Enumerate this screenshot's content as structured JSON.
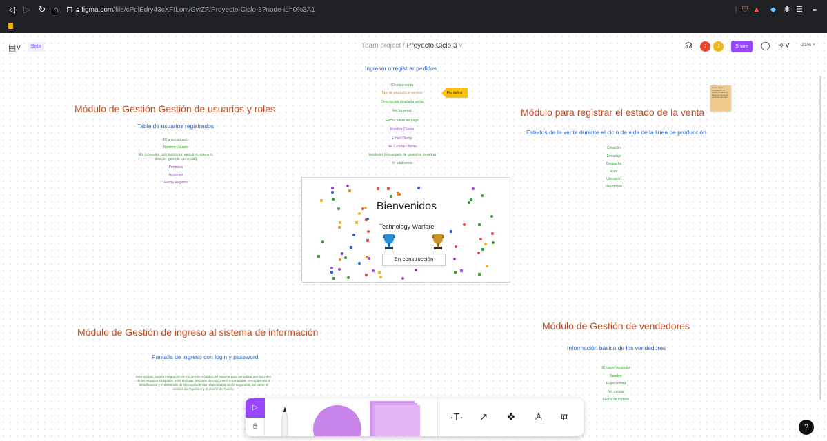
{
  "browser": {
    "host": "figma.com",
    "path": "/file/cPqlEdry43cXFfLonvGwZF/Proyecto-Ciclo-3?node-id=0%3A1"
  },
  "figma": {
    "beta_label": "Beta",
    "team": "Team project",
    "separator": "/",
    "file_name": "Proyecto Ciclo 3",
    "share_label": "Share",
    "zoom": "21%",
    "avatar_1": "J",
    "avatar_2": "J",
    "colors": {
      "accent": "#9747ff",
      "section_title": "#c54a1f",
      "subtitle": "#2a63c7",
      "item_green": "#33a02c",
      "item_purple": "#9b45d6"
    }
  },
  "board": {
    "pedidos": {
      "subtitle": "Ingresar o registrar  pedidos",
      "items": [
        "ID unico venta",
        "Tipo de producto o servicio",
        "Descripcion detallada venta",
        "Fecha venat",
        "Fecha futuro de pago",
        "Nombre Cliente",
        "Email Cliente",
        "No. Celular Cliente",
        "Vendedor (Encargado de gestionar la venta)",
        "Vr total venta"
      ],
      "tag": "Por definir"
    },
    "usuarios": {
      "title": "Módulo de Gestión Gestión de usuarios y roles",
      "subtitle": "Tabla de usuarios registrados",
      "items": [
        "ID unico usuario",
        "Nombre Usuario",
        "Rol (consultor, administrador, ejecutivo, operario,",
        "director, gerente comercial)",
        "Permisos",
        "Acciones",
        "Fecha Registro"
      ]
    },
    "estado": {
      "title": "Módulo para registrar el estado de la venta",
      "subtitle": "Estados de la venta durante el ciclo de vida de la linea de producción",
      "items": [
        "Creación",
        "Embalaje",
        "Despacho",
        "Ruta",
        "Ubicación",
        "Recepción"
      ],
      "sticky_note": "Definir mejor, comparando el estado de datos de datos en tiempo de venta. de alto valor"
    },
    "hero": {
      "title": "Bienvenidos",
      "subtitle": "Technology Warfare",
      "button": "En construcción"
    },
    "ingreso": {
      "title": "Módulo de Gestión de ingreso al sistema de información",
      "subtitle": "Pantalla de ingreso con login y password",
      "paragraph": "Este módulo hará la integración de los demás módulos del sistema para garantizar que los roles de los usuarios se ajusten a las distintas opciones de cada menú o formulario. Se contempla la identificación y el desarrollo de los casos de uso relacionados con la seguridad, así como el análisis de requisitos y el diseño del mismo."
    },
    "vendedores": {
      "title": "Módulo de Gestión de vendedores",
      "subtitle": "Información básica de los vendedores",
      "items": [
        "ID unico Vendedor",
        "Nombre",
        "Especialidad",
        "No. celular",
        "Fecha de ingreso"
      ]
    }
  },
  "toolbar": {
    "text_tool": "T",
    "help": "?"
  }
}
